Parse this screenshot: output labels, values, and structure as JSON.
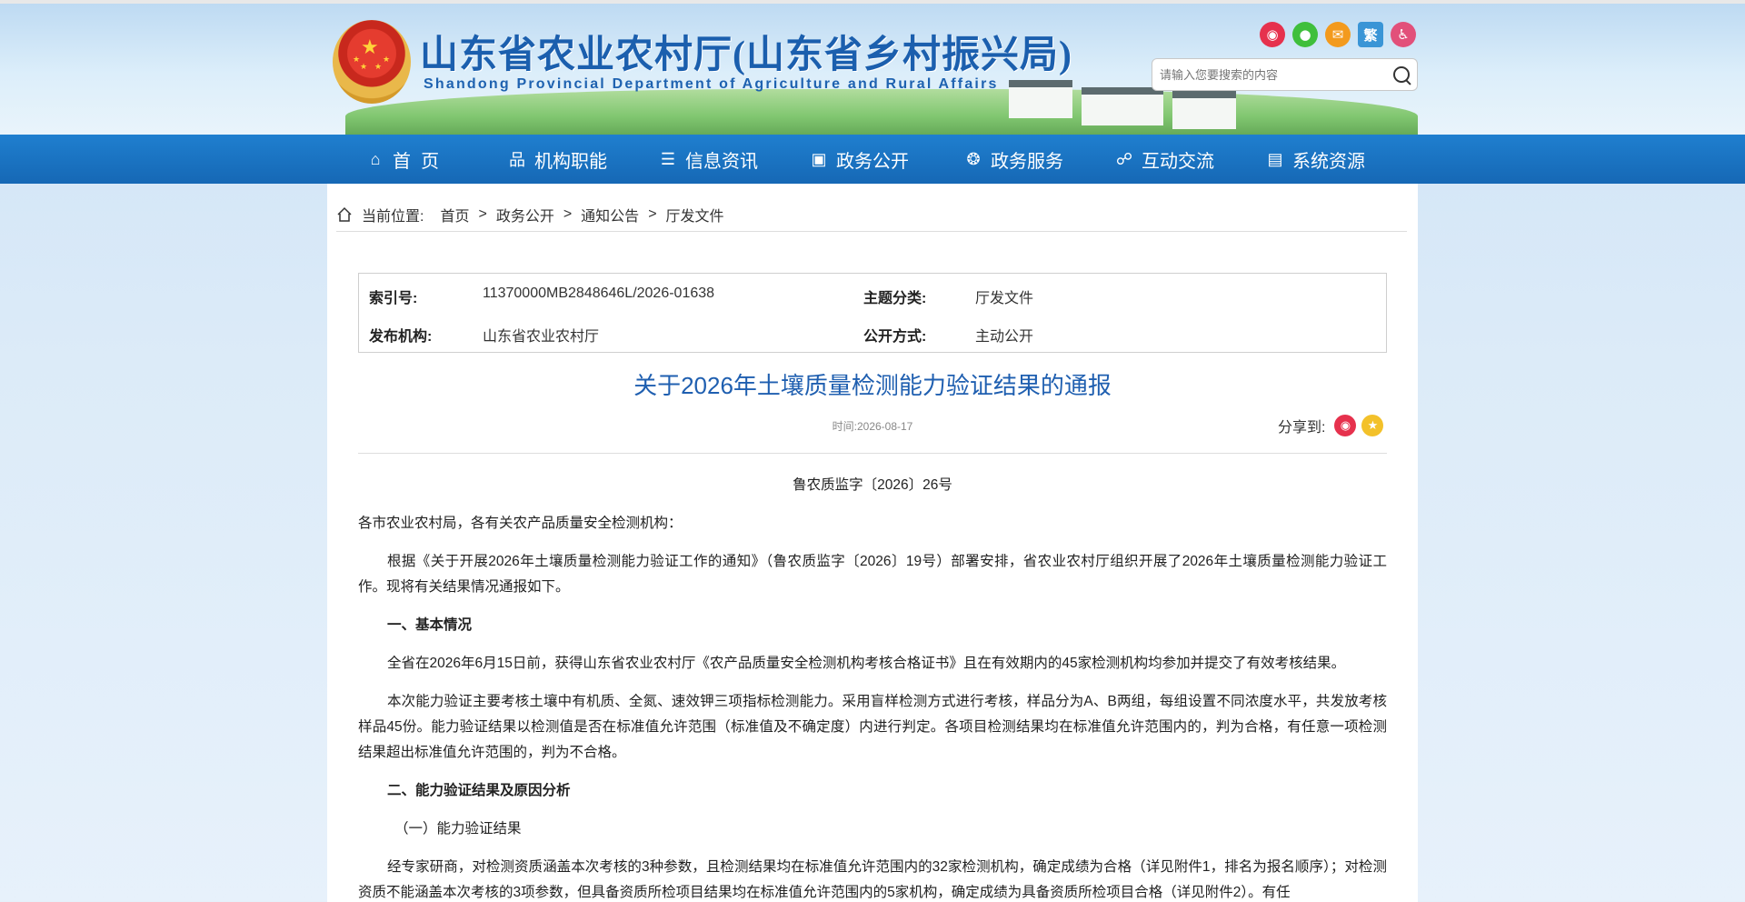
{
  "header": {
    "title": "山东省农业农村厅(山东省乡村振兴局)",
    "subtitle": "Shandong Provincial Department of Agriculture and Rural Affairs",
    "traditional_label": "繁",
    "search_placeholder": "请输入您要搜索的内容",
    "social_icons": [
      "weibo-icon",
      "wechat-icon",
      "mail-icon",
      "traditional-chinese-toggle",
      "accessibility-icon"
    ]
  },
  "nav": {
    "items": [
      {
        "label": "首  页",
        "icon": "home-icon"
      },
      {
        "label": "机构职能",
        "icon": "org-icon"
      },
      {
        "label": "信息资讯",
        "icon": "document-icon"
      },
      {
        "label": "政务公开",
        "icon": "archive-icon"
      },
      {
        "label": "政务服务",
        "icon": "service-icon"
      },
      {
        "label": "互动交流",
        "icon": "chat-icon"
      },
      {
        "label": "系统资源",
        "icon": "resource-icon"
      }
    ]
  },
  "breadcrumb": {
    "prefix": "当前位置:",
    "items": [
      "首页",
      "政务公开",
      "通知公告",
      "厅发文件"
    ],
    "separator": ">"
  },
  "meta": {
    "index_label": "索引号:",
    "index_value": "11370000MB2848646L/2026-01638",
    "topic_label": "主题分类:",
    "topic_value": "厅发文件",
    "publisher_label": "发布机构:",
    "publisher_value": "山东省农业农村厅",
    "disclosure_label": "公开方式:",
    "disclosure_value": "主动公开"
  },
  "article": {
    "title": "关于2026年土壤质量检测能力验证结果的通报",
    "time": "时间:2026-08-17",
    "share_label": "分享到:",
    "doc_no": "鲁农质监字〔2026〕26号",
    "salutation": "各市农业农村局，各有关农产品质量安全检测机构：",
    "p1": "根据《关于开展2026年土壤质量检测能力验证工作的通知》（鲁农质监字〔2026〕19号）部署安排，省农业农村厅组织开展了2026年土壤质量检测能力验证工作。现将有关结果情况通报如下。",
    "h1": "一、基本情况",
    "p2": "全省在2026年6月15日前，获得山东省农业农村厅《农产品质量安全检测机构考核合格证书》且在有效期内的45家检测机构均参加并提交了有效考核结果。",
    "p3": "本次能力验证主要考核土壤中有机质、全氮、速效钾三项指标检测能力。采用盲样检测方式进行考核，样品分为A、B两组，每组设置不同浓度水平，共发放考核样品45份。能力验证结果以检测值是否在标准值允许范围（标准值及不确定度）内进行判定。各项目检测结果均在标准值允许范围内的，判为合格，有任意一项检测结果超出标准值允许范围的，判为不合格。",
    "h2": "二、能力验证结果及原因分析",
    "sub1": "（一）能力验证结果",
    "p4": "经专家研商，对检测资质涵盖本次考核的3种参数，且检测结果均在标准值允许范围内的32家检测机构，确定成绩为合格（详见附件1，排名为报名顺序）；对检测资质不能涵盖本次考核的3项参数，但具备资质所检项目结果均在标准值允许范围内的5家机构，确定成绩为具备资质所检项目合格（详见附件2）。有任"
  }
}
